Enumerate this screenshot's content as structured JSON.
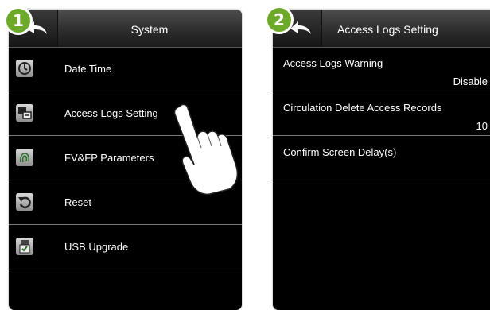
{
  "steps": [
    "1",
    "2"
  ],
  "screen1": {
    "title": "System",
    "menu": [
      {
        "label": "Date Time",
        "icon": "clock-icon"
      },
      {
        "label": "Access Logs Setting",
        "icon": "access-logs-icon"
      },
      {
        "label": "FV&FP Parameters",
        "icon": "fingerprint-icon"
      },
      {
        "label": "Reset",
        "icon": "reset-icon"
      },
      {
        "label": "USB Upgrade",
        "icon": "usb-icon"
      }
    ]
  },
  "screen2": {
    "title": "Access Logs Setting",
    "settings": [
      {
        "name": "Access Logs Warning",
        "value": "Disable"
      },
      {
        "name": "Circulation Delete Access Records",
        "value": "10"
      },
      {
        "name": "Confirm Screen Delay(s)",
        "value": ""
      }
    ]
  },
  "colors": {
    "badge": "#6eaa2a",
    "screen_bg": "#000000",
    "divider": "#7a7a7a"
  }
}
